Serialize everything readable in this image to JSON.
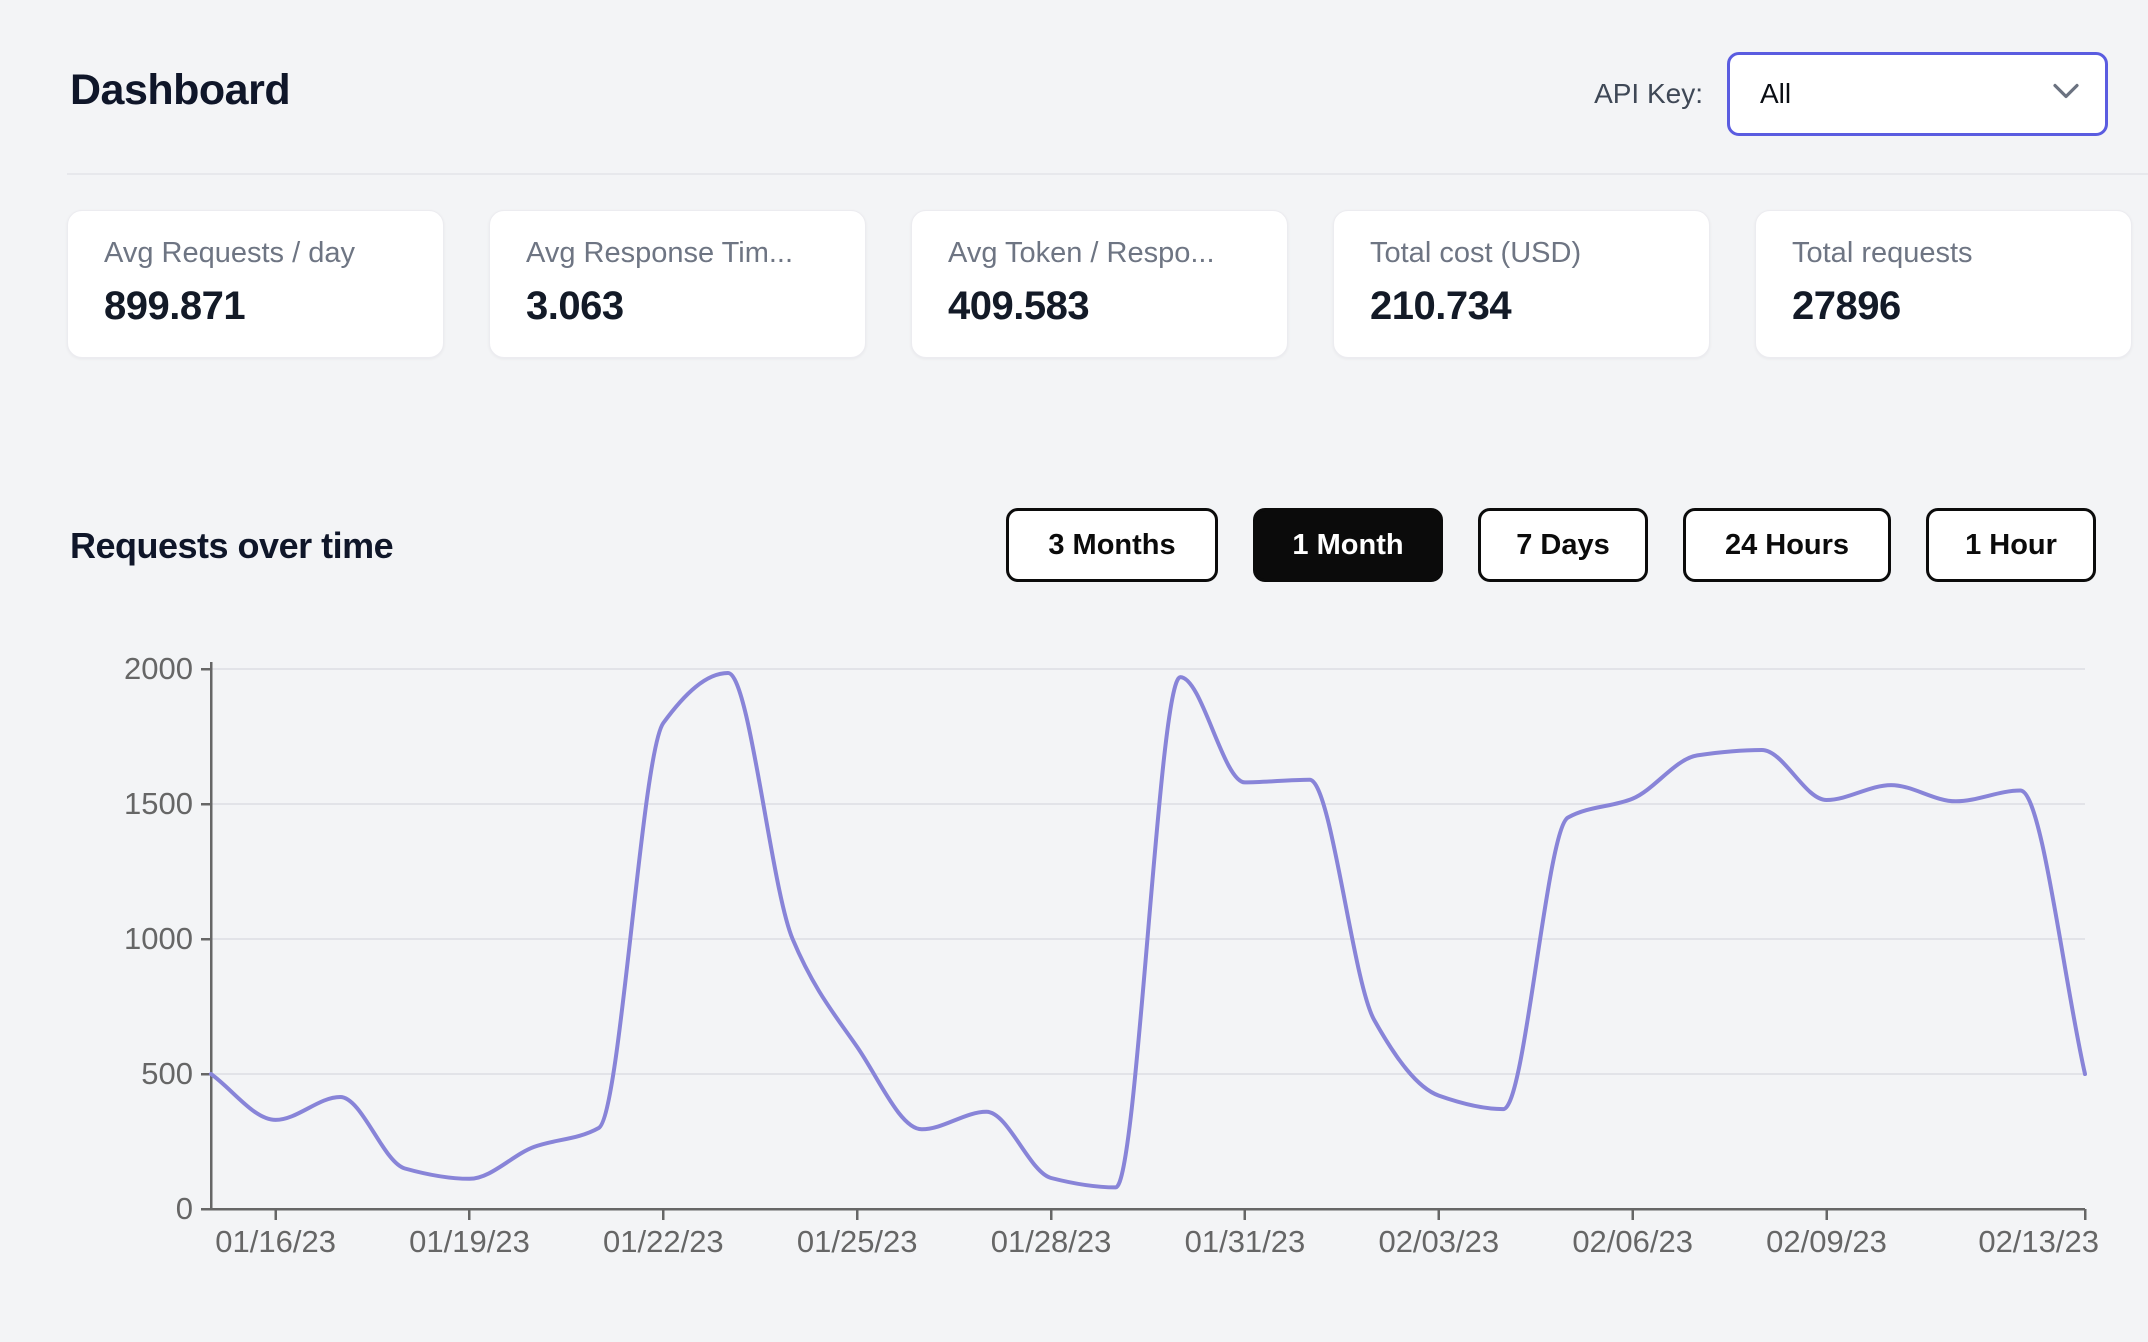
{
  "header": {
    "title": "Dashboard",
    "api_key_label": "API Key:",
    "api_key_value": "All"
  },
  "stat_cards": [
    {
      "label": "Avg Requests / day",
      "value": "899.871"
    },
    {
      "label": "Avg Response Tim...",
      "value": "3.063"
    },
    {
      "label": "Avg Token / Respo...",
      "value": "409.583"
    },
    {
      "label": "Total cost (USD)",
      "value": "210.734"
    },
    {
      "label": "Total requests",
      "value": "27896"
    }
  ],
  "section": {
    "title": "Requests over time",
    "range_buttons": [
      {
        "label": "3 Months",
        "selected": false
      },
      {
        "label": "1 Month",
        "selected": true
      },
      {
        "label": "7 Days",
        "selected": false
      },
      {
        "label": "24 Hours",
        "selected": false
      },
      {
        "label": "1 Hour",
        "selected": false
      }
    ]
  },
  "colors": {
    "background": "#f3f4f6",
    "line": "#8884d8",
    "axis": "#666666",
    "gridline": "#e2e3e8",
    "select_border": "#5a5ce0",
    "button_black": "#0b0b0b"
  },
  "chart_data": {
    "type": "line",
    "title": "Requests over time",
    "xlabel": "",
    "ylabel": "",
    "ylim": [
      0,
      2000
    ],
    "yticks": [
      0,
      500,
      1000,
      1500,
      2000
    ],
    "grid": "horizontal",
    "legend": "none",
    "line_interpolation": "monotone",
    "x_dates": [
      "01/15/23",
      "01/16/23",
      "01/17/23",
      "01/18/23",
      "01/19/23",
      "01/20/23",
      "01/21/23",
      "01/22/23",
      "01/23/23",
      "01/24/23",
      "01/25/23",
      "01/26/23",
      "01/27/23",
      "01/28/23",
      "01/29/23",
      "01/30/23",
      "01/31/23",
      "02/01/23",
      "02/02/23",
      "02/03/23",
      "02/04/23",
      "02/05/23",
      "02/06/23",
      "02/07/23",
      "02/08/23",
      "02/09/23",
      "02/10/23",
      "02/11/23",
      "02/12/23",
      "02/13/23"
    ],
    "series": [
      {
        "name": "requests",
        "color": "#8884d8",
        "values": [
          500,
          330,
          415,
          150,
          112,
          230,
          300,
          1800,
          1985,
          1000,
          600,
          295,
          360,
          115,
          80,
          1970,
          1580,
          1590,
          700,
          420,
          370,
          1450,
          1520,
          1680,
          1700,
          1515,
          1570,
          1510,
          1550,
          500
        ]
      }
    ],
    "x_tick_labels": [
      "01/16/23",
      "01/19/23",
      "01/22/23",
      "01/25/23",
      "01/28/23",
      "01/31/23",
      "02/03/23",
      "02/06/23",
      "02/09/23",
      "02/13/23"
    ],
    "x_tick_day_index": [
      1,
      4,
      7,
      10,
      13,
      16,
      19,
      22,
      25,
      29
    ]
  }
}
